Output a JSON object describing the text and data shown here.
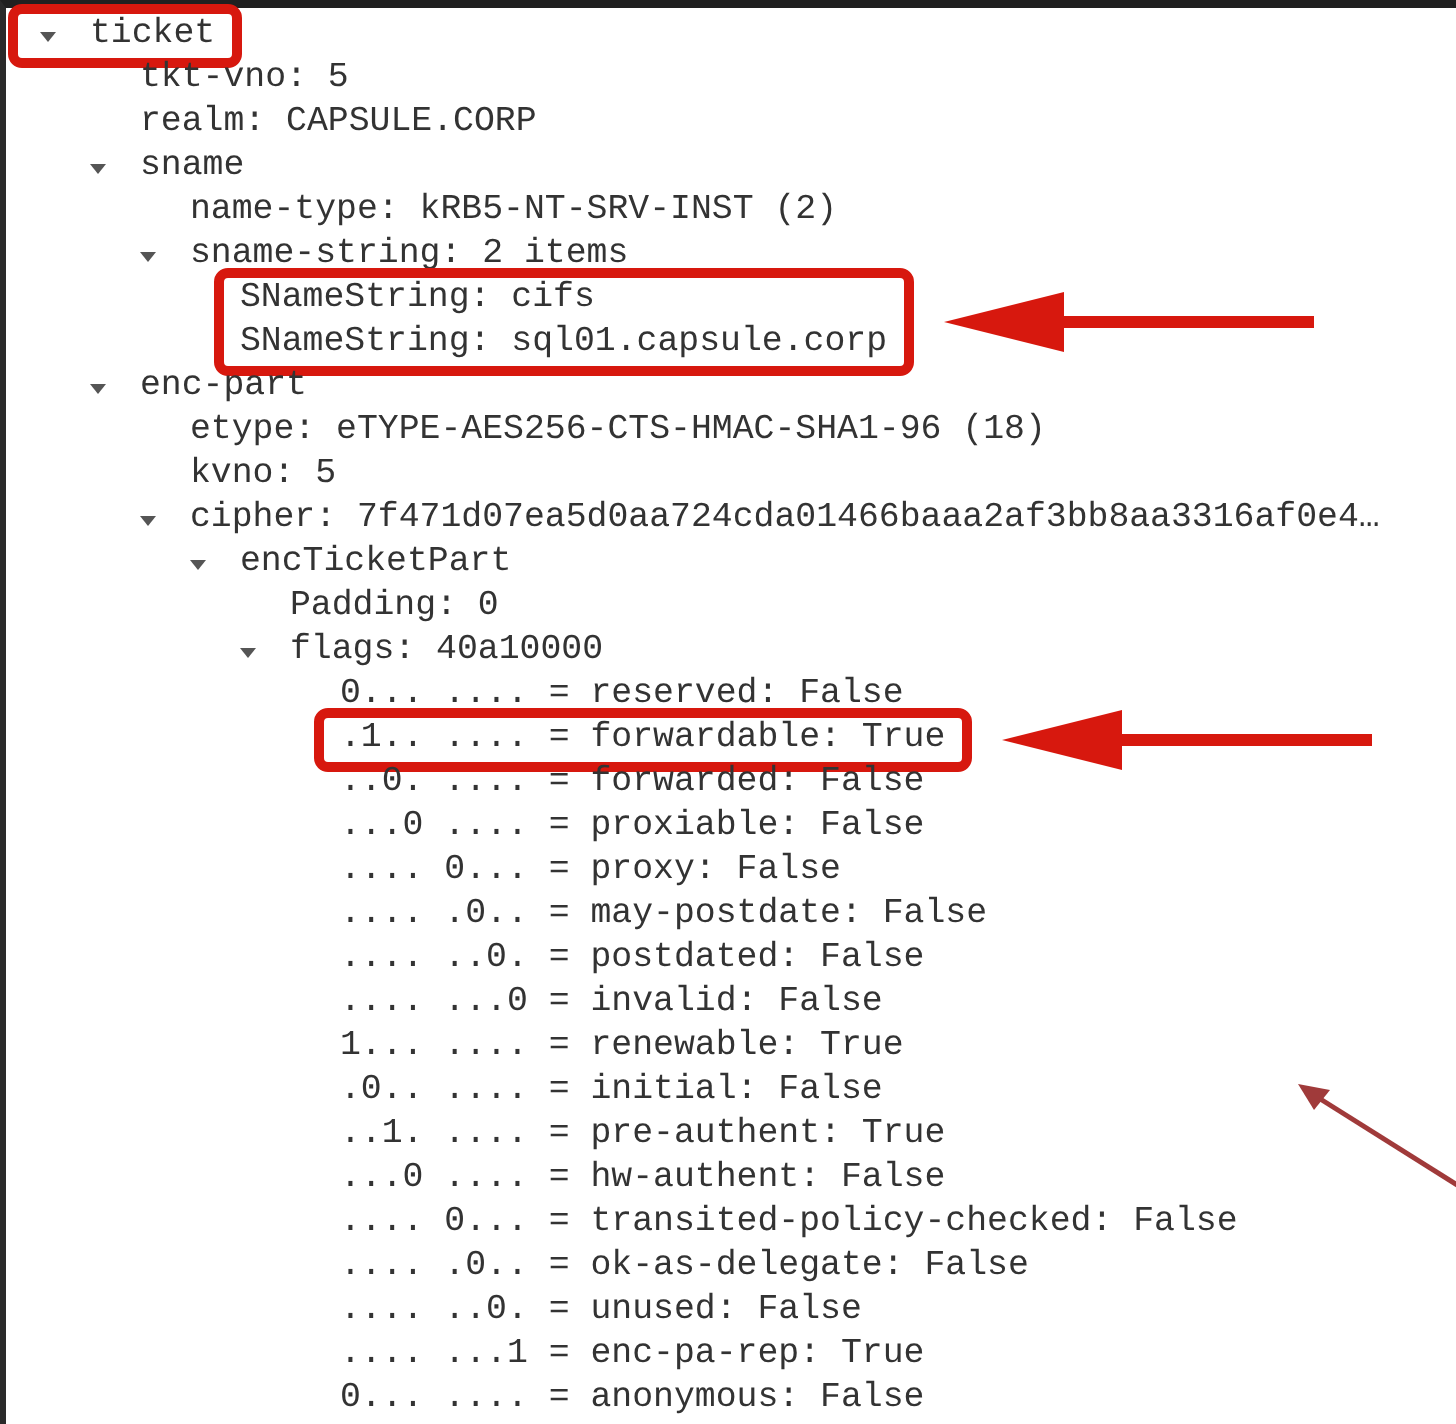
{
  "tree": [
    {
      "label": "ticket",
      "expanded": true,
      "highlighted": true,
      "pointer": false,
      "children": [
        {
          "label": "tkt-vno: 5",
          "highlighted": false,
          "pointer": false
        },
        {
          "label": "realm: CAPSULE.CORP",
          "highlighted": false,
          "pointer": false
        },
        {
          "label": "sname",
          "expanded": true,
          "highlighted": false,
          "pointer": false,
          "children": [
            {
              "label": "name-type: kRB5-NT-SRV-INST (2)",
              "highlighted": false,
              "pointer": false
            },
            {
              "label": "sname-string: 2 items",
              "expanded": true,
              "highlighted": false,
              "pointer": false,
              "children": [
                {
                  "label": "SNameString: cifs",
                  "highlighted": true,
                  "pointer": true
                },
                {
                  "label": "SNameString: sql01.capsule.corp",
                  "highlighted": true,
                  "pointer": false
                }
              ]
            }
          ]
        },
        {
          "label": "enc-part",
          "expanded": true,
          "highlighted": false,
          "pointer": false,
          "children": [
            {
              "label": "etype: eTYPE-AES256-CTS-HMAC-SHA1-96 (18)",
              "highlighted": false,
              "pointer": false
            },
            {
              "label": "kvno: 5",
              "highlighted": false,
              "pointer": false
            },
            {
              "label": "cipher: 7f471d07ea5d0aa724cda01466baaa2af3bb8aa3316af0e4…",
              "expanded": true,
              "highlighted": false,
              "pointer": false,
              "children": [
                {
                  "label": "encTicketPart",
                  "expanded": true,
                  "highlighted": false,
                  "pointer": false,
                  "children": [
                    {
                      "label": "Padding: 0",
                      "highlighted": false,
                      "pointer": false
                    },
                    {
                      "label": "flags: 40a10000",
                      "expanded": true,
                      "highlighted": false,
                      "pointer": false,
                      "children": [
                        {
                          "label": "0... .... = reserved: False",
                          "highlighted": false,
                          "pointer": false
                        },
                        {
                          "label": ".1.. .... = forwardable: True",
                          "highlighted": true,
                          "pointer": true
                        },
                        {
                          "label": "..0. .... = forwarded: False",
                          "highlighted": false,
                          "pointer": false
                        },
                        {
                          "label": "...0 .... = proxiable: False",
                          "highlighted": false,
                          "pointer": false
                        },
                        {
                          "label": ".... 0... = proxy: False",
                          "highlighted": false,
                          "pointer": false
                        },
                        {
                          "label": ".... .0.. = may-postdate: False",
                          "highlighted": false,
                          "pointer": false
                        },
                        {
                          "label": ".... ..0. = postdated: False",
                          "highlighted": false,
                          "pointer": false
                        },
                        {
                          "label": ".... ...0 = invalid: False",
                          "highlighted": false,
                          "pointer": false
                        },
                        {
                          "label": "1... .... = renewable: True",
                          "highlighted": false,
                          "pointer": false
                        },
                        {
                          "label": ".0.. .... = initial: False",
                          "highlighted": false,
                          "pointer": false
                        },
                        {
                          "label": "..1. .... = pre-authent: True",
                          "highlighted": false,
                          "pointer": false
                        },
                        {
                          "label": "...0 .... = hw-authent: False",
                          "highlighted": false,
                          "pointer": false
                        },
                        {
                          "label": ".... 0... = transited-policy-checked: False",
                          "highlighted": false,
                          "pointer": false
                        },
                        {
                          "label": ".... .0.. = ok-as-delegate: False",
                          "highlighted": false,
                          "pointer": false
                        },
                        {
                          "label": ".... ..0. = unused: False",
                          "highlighted": false,
                          "pointer": false
                        },
                        {
                          "label": ".... ...1 = enc-pa-rep: True",
                          "highlighted": false,
                          "pointer": false
                        },
                        {
                          "label": "0... .... = anonymous: False",
                          "highlighted": false,
                          "pointer": false
                        }
                      ]
                    }
                  ]
                }
              ]
            }
          ]
        }
      ]
    }
  ]
}
